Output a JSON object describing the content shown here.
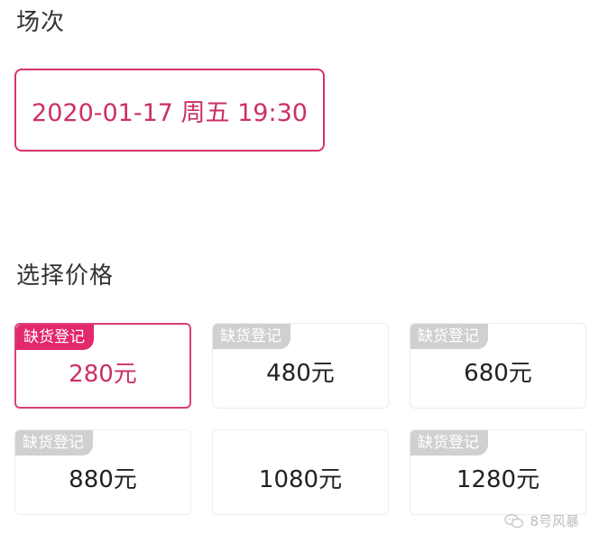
{
  "session": {
    "title": "场次",
    "selected": "2020-01-17 周五 19:30"
  },
  "price": {
    "title": "选择价格",
    "badge_label": "缺货登记",
    "options": [
      {
        "label": "280元",
        "badge": "缺货登记",
        "selected": true
      },
      {
        "label": "480元",
        "badge": "缺货登记",
        "selected": false
      },
      {
        "label": "680元",
        "badge": "缺货登记",
        "selected": false
      },
      {
        "label": "880元",
        "badge": "缺货登记",
        "selected": false
      },
      {
        "label": "1080元",
        "badge": "",
        "selected": false
      },
      {
        "label": "1280元",
        "badge": "缺货登记",
        "selected": false
      }
    ]
  },
  "watermark": {
    "text": "8号风暴",
    "icon": "chat-bubbles-icon"
  },
  "colors": {
    "accent": "#d6336f",
    "badge_active": "#e3286b",
    "badge_inactive": "#d0d0d0"
  }
}
